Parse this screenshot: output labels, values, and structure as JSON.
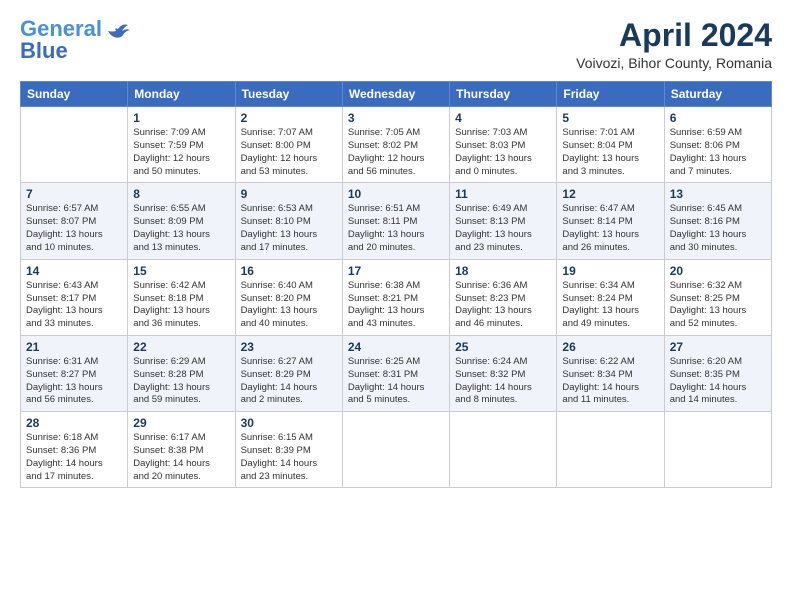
{
  "logo": {
    "line1": "General",
    "line2": "Blue"
  },
  "title": "April 2024",
  "subtitle": "Voivozi, Bihor County, Romania",
  "days_header": [
    "Sunday",
    "Monday",
    "Tuesday",
    "Wednesday",
    "Thursday",
    "Friday",
    "Saturday"
  ],
  "weeks": [
    [
      {
        "num": "",
        "info": ""
      },
      {
        "num": "1",
        "info": "Sunrise: 7:09 AM\nSunset: 7:59 PM\nDaylight: 12 hours\nand 50 minutes."
      },
      {
        "num": "2",
        "info": "Sunrise: 7:07 AM\nSunset: 8:00 PM\nDaylight: 12 hours\nand 53 minutes."
      },
      {
        "num": "3",
        "info": "Sunrise: 7:05 AM\nSunset: 8:02 PM\nDaylight: 12 hours\nand 56 minutes."
      },
      {
        "num": "4",
        "info": "Sunrise: 7:03 AM\nSunset: 8:03 PM\nDaylight: 13 hours\nand 0 minutes."
      },
      {
        "num": "5",
        "info": "Sunrise: 7:01 AM\nSunset: 8:04 PM\nDaylight: 13 hours\nand 3 minutes."
      },
      {
        "num": "6",
        "info": "Sunrise: 6:59 AM\nSunset: 8:06 PM\nDaylight: 13 hours\nand 7 minutes."
      }
    ],
    [
      {
        "num": "7",
        "info": "Sunrise: 6:57 AM\nSunset: 8:07 PM\nDaylight: 13 hours\nand 10 minutes."
      },
      {
        "num": "8",
        "info": "Sunrise: 6:55 AM\nSunset: 8:09 PM\nDaylight: 13 hours\nand 13 minutes."
      },
      {
        "num": "9",
        "info": "Sunrise: 6:53 AM\nSunset: 8:10 PM\nDaylight: 13 hours\nand 17 minutes."
      },
      {
        "num": "10",
        "info": "Sunrise: 6:51 AM\nSunset: 8:11 PM\nDaylight: 13 hours\nand 20 minutes."
      },
      {
        "num": "11",
        "info": "Sunrise: 6:49 AM\nSunset: 8:13 PM\nDaylight: 13 hours\nand 23 minutes."
      },
      {
        "num": "12",
        "info": "Sunrise: 6:47 AM\nSunset: 8:14 PM\nDaylight: 13 hours\nand 26 minutes."
      },
      {
        "num": "13",
        "info": "Sunrise: 6:45 AM\nSunset: 8:16 PM\nDaylight: 13 hours\nand 30 minutes."
      }
    ],
    [
      {
        "num": "14",
        "info": "Sunrise: 6:43 AM\nSunset: 8:17 PM\nDaylight: 13 hours\nand 33 minutes."
      },
      {
        "num": "15",
        "info": "Sunrise: 6:42 AM\nSunset: 8:18 PM\nDaylight: 13 hours\nand 36 minutes."
      },
      {
        "num": "16",
        "info": "Sunrise: 6:40 AM\nSunset: 8:20 PM\nDaylight: 13 hours\nand 40 minutes."
      },
      {
        "num": "17",
        "info": "Sunrise: 6:38 AM\nSunset: 8:21 PM\nDaylight: 13 hours\nand 43 minutes."
      },
      {
        "num": "18",
        "info": "Sunrise: 6:36 AM\nSunset: 8:23 PM\nDaylight: 13 hours\nand 46 minutes."
      },
      {
        "num": "19",
        "info": "Sunrise: 6:34 AM\nSunset: 8:24 PM\nDaylight: 13 hours\nand 49 minutes."
      },
      {
        "num": "20",
        "info": "Sunrise: 6:32 AM\nSunset: 8:25 PM\nDaylight: 13 hours\nand 52 minutes."
      }
    ],
    [
      {
        "num": "21",
        "info": "Sunrise: 6:31 AM\nSunset: 8:27 PM\nDaylight: 13 hours\nand 56 minutes."
      },
      {
        "num": "22",
        "info": "Sunrise: 6:29 AM\nSunset: 8:28 PM\nDaylight: 13 hours\nand 59 minutes."
      },
      {
        "num": "23",
        "info": "Sunrise: 6:27 AM\nSunset: 8:29 PM\nDaylight: 14 hours\nand 2 minutes."
      },
      {
        "num": "24",
        "info": "Sunrise: 6:25 AM\nSunset: 8:31 PM\nDaylight: 14 hours\nand 5 minutes."
      },
      {
        "num": "25",
        "info": "Sunrise: 6:24 AM\nSunset: 8:32 PM\nDaylight: 14 hours\nand 8 minutes."
      },
      {
        "num": "26",
        "info": "Sunrise: 6:22 AM\nSunset: 8:34 PM\nDaylight: 14 hours\nand 11 minutes."
      },
      {
        "num": "27",
        "info": "Sunrise: 6:20 AM\nSunset: 8:35 PM\nDaylight: 14 hours\nand 14 minutes."
      }
    ],
    [
      {
        "num": "28",
        "info": "Sunrise: 6:18 AM\nSunset: 8:36 PM\nDaylight: 14 hours\nand 17 minutes."
      },
      {
        "num": "29",
        "info": "Sunrise: 6:17 AM\nSunset: 8:38 PM\nDaylight: 14 hours\nand 20 minutes."
      },
      {
        "num": "30",
        "info": "Sunrise: 6:15 AM\nSunset: 8:39 PM\nDaylight: 14 hours\nand 23 minutes."
      },
      {
        "num": "",
        "info": ""
      },
      {
        "num": "",
        "info": ""
      },
      {
        "num": "",
        "info": ""
      },
      {
        "num": "",
        "info": ""
      }
    ]
  ]
}
